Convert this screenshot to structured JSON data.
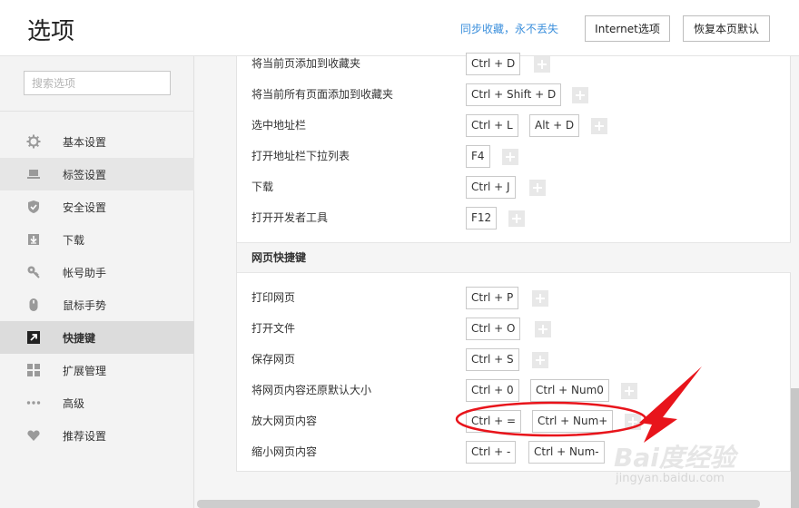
{
  "header": {
    "title": "选项",
    "sync_link": "同步收藏，永不丢失",
    "internet_button": "Internet选项",
    "reset_button": "恢复本页默认"
  },
  "sidebar": {
    "search_placeholder": "搜索选项",
    "items": [
      {
        "label": "基本设置",
        "icon": "gear-icon"
      },
      {
        "label": "标签设置",
        "icon": "laptop-icon"
      },
      {
        "label": "安全设置",
        "icon": "shield-icon"
      },
      {
        "label": "下载",
        "icon": "download-icon"
      },
      {
        "label": "帐号助手",
        "icon": "key-icon"
      },
      {
        "label": "鼠标手势",
        "icon": "mouse-icon"
      },
      {
        "label": "快捷键",
        "icon": "shortcut-arrow-icon"
      },
      {
        "label": "扩展管理",
        "icon": "grid-icon"
      },
      {
        "label": "高级",
        "icon": "dots-icon"
      },
      {
        "label": "推荐设置",
        "icon": "heart-icon"
      }
    ],
    "active": "快捷键"
  },
  "shortcuts_top": [
    {
      "label": "将当前页添加到收藏夹",
      "keys": [
        "Ctrl + D"
      ]
    },
    {
      "label": "将当前所有页面添加到收藏夹",
      "keys": [
        "Ctrl + Shift + D"
      ]
    },
    {
      "label": "选中地址栏",
      "keys": [
        "Ctrl + L",
        "Alt + D"
      ]
    },
    {
      "label": "打开地址栏下拉列表",
      "keys": [
        "F4"
      ]
    },
    {
      "label": "下载",
      "keys": [
        "Ctrl + J"
      ]
    },
    {
      "label": "打开开发者工具",
      "keys": [
        "F12"
      ]
    }
  ],
  "webpage_section": {
    "title": "网页快捷键",
    "shortcuts": [
      {
        "label": "打印网页",
        "keys": [
          "Ctrl + P"
        ]
      },
      {
        "label": "打开文件",
        "keys": [
          "Ctrl + O"
        ]
      },
      {
        "label": "保存网页",
        "keys": [
          "Ctrl + S"
        ]
      },
      {
        "label": "将网页内容还原默认大小",
        "keys": [
          "Ctrl + 0",
          "Ctrl + Num0"
        ]
      },
      {
        "label": "放大网页内容",
        "keys": [
          "Ctrl + =",
          "Ctrl + Num+"
        ]
      },
      {
        "label": "缩小网页内容",
        "keys": [
          "Ctrl + -",
          "Ctrl + Num-"
        ]
      }
    ]
  },
  "watermark": {
    "text": "Bai度经验",
    "sub": "jingyan.baidu.com"
  },
  "colors": {
    "link": "#3b8fdc",
    "annotation": "#e8141b",
    "active_bg": "#dcdcdc"
  }
}
